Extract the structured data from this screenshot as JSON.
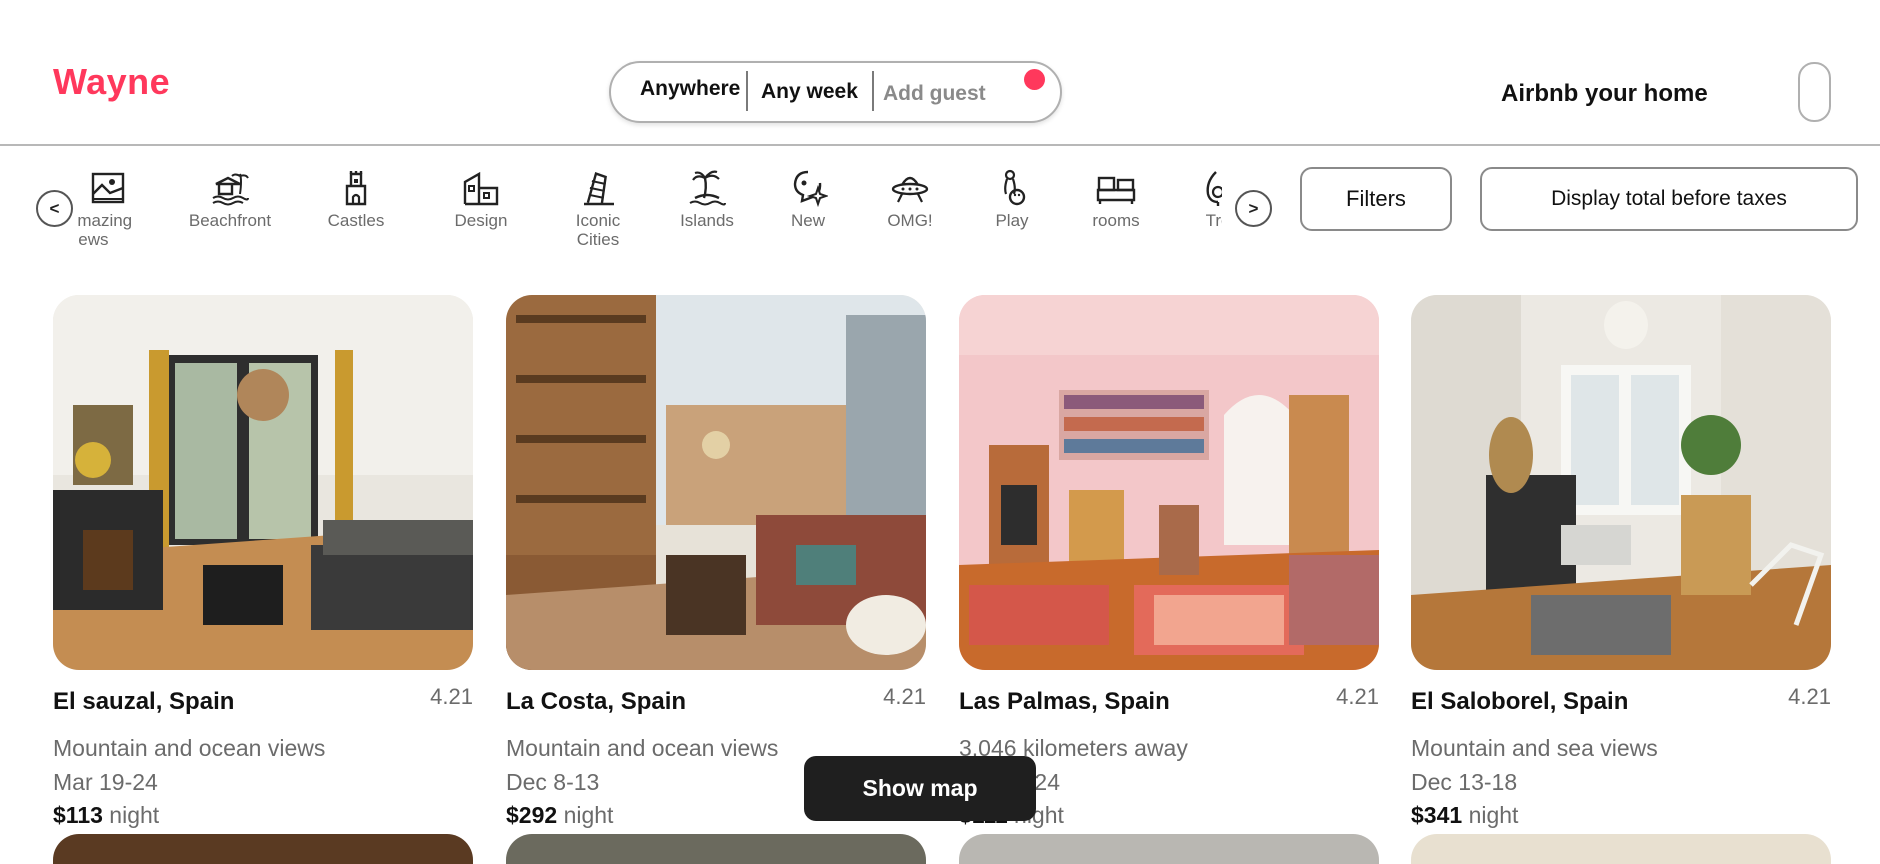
{
  "header": {
    "logo": "Wayne",
    "search": {
      "anywhere": "Anywhere",
      "week": "Any week",
      "guest": "Add guest"
    },
    "host_link": "Airbnb your home"
  },
  "categories": {
    "prev_label": "<",
    "next_label": ">",
    "items": [
      {
        "label": "Amazing views",
        "icon": "amazing-views-icon"
      },
      {
        "label": "Beachfront",
        "icon": "beachfront-icon"
      },
      {
        "label": "Castles",
        "icon": "castle-icon"
      },
      {
        "label": "Design",
        "icon": "design-icon"
      },
      {
        "label": "Iconic Cities",
        "icon": "iconic-cities-icon"
      },
      {
        "label": "Islands",
        "icon": "islands-icon"
      },
      {
        "label": "New",
        "icon": "new-icon"
      },
      {
        "label": "OMG!",
        "icon": "omg-icon"
      },
      {
        "label": "Play",
        "icon": "play-icon"
      },
      {
        "label": "rooms",
        "icon": "rooms-icon"
      },
      {
        "label": "Tre",
        "icon": "treehouse-icon"
      }
    ],
    "filters": "Filters",
    "taxes": "Display total before taxes"
  },
  "listings": [
    {
      "title": "El sauzal, Spain",
      "rating": "4.21",
      "desc": "Mountain and ocean views",
      "dates": "Mar 19-24",
      "price": "$113",
      "unit": "night"
    },
    {
      "title": "La Costa, Spain",
      "rating": "4.21",
      "desc": "Mountain and ocean views",
      "dates": "Dec 8-13",
      "price": "$292",
      "unit": "night"
    },
    {
      "title": "Las Palmas, Spain",
      "rating": "4.21",
      "desc": "3,046 kilometers away",
      "dates": "Apr 18-24",
      "price": "$111",
      "unit": "night"
    },
    {
      "title": "El Saloborel, Spain",
      "rating": "4.21",
      "desc": "Mountain and sea views",
      "dates": "Dec 13-18",
      "price": "$341",
      "unit": "night"
    }
  ],
  "show_map": "Show map",
  "colors": {
    "brand": "#ff385c",
    "text": "#222222",
    "muted": "#6b6b6b"
  }
}
